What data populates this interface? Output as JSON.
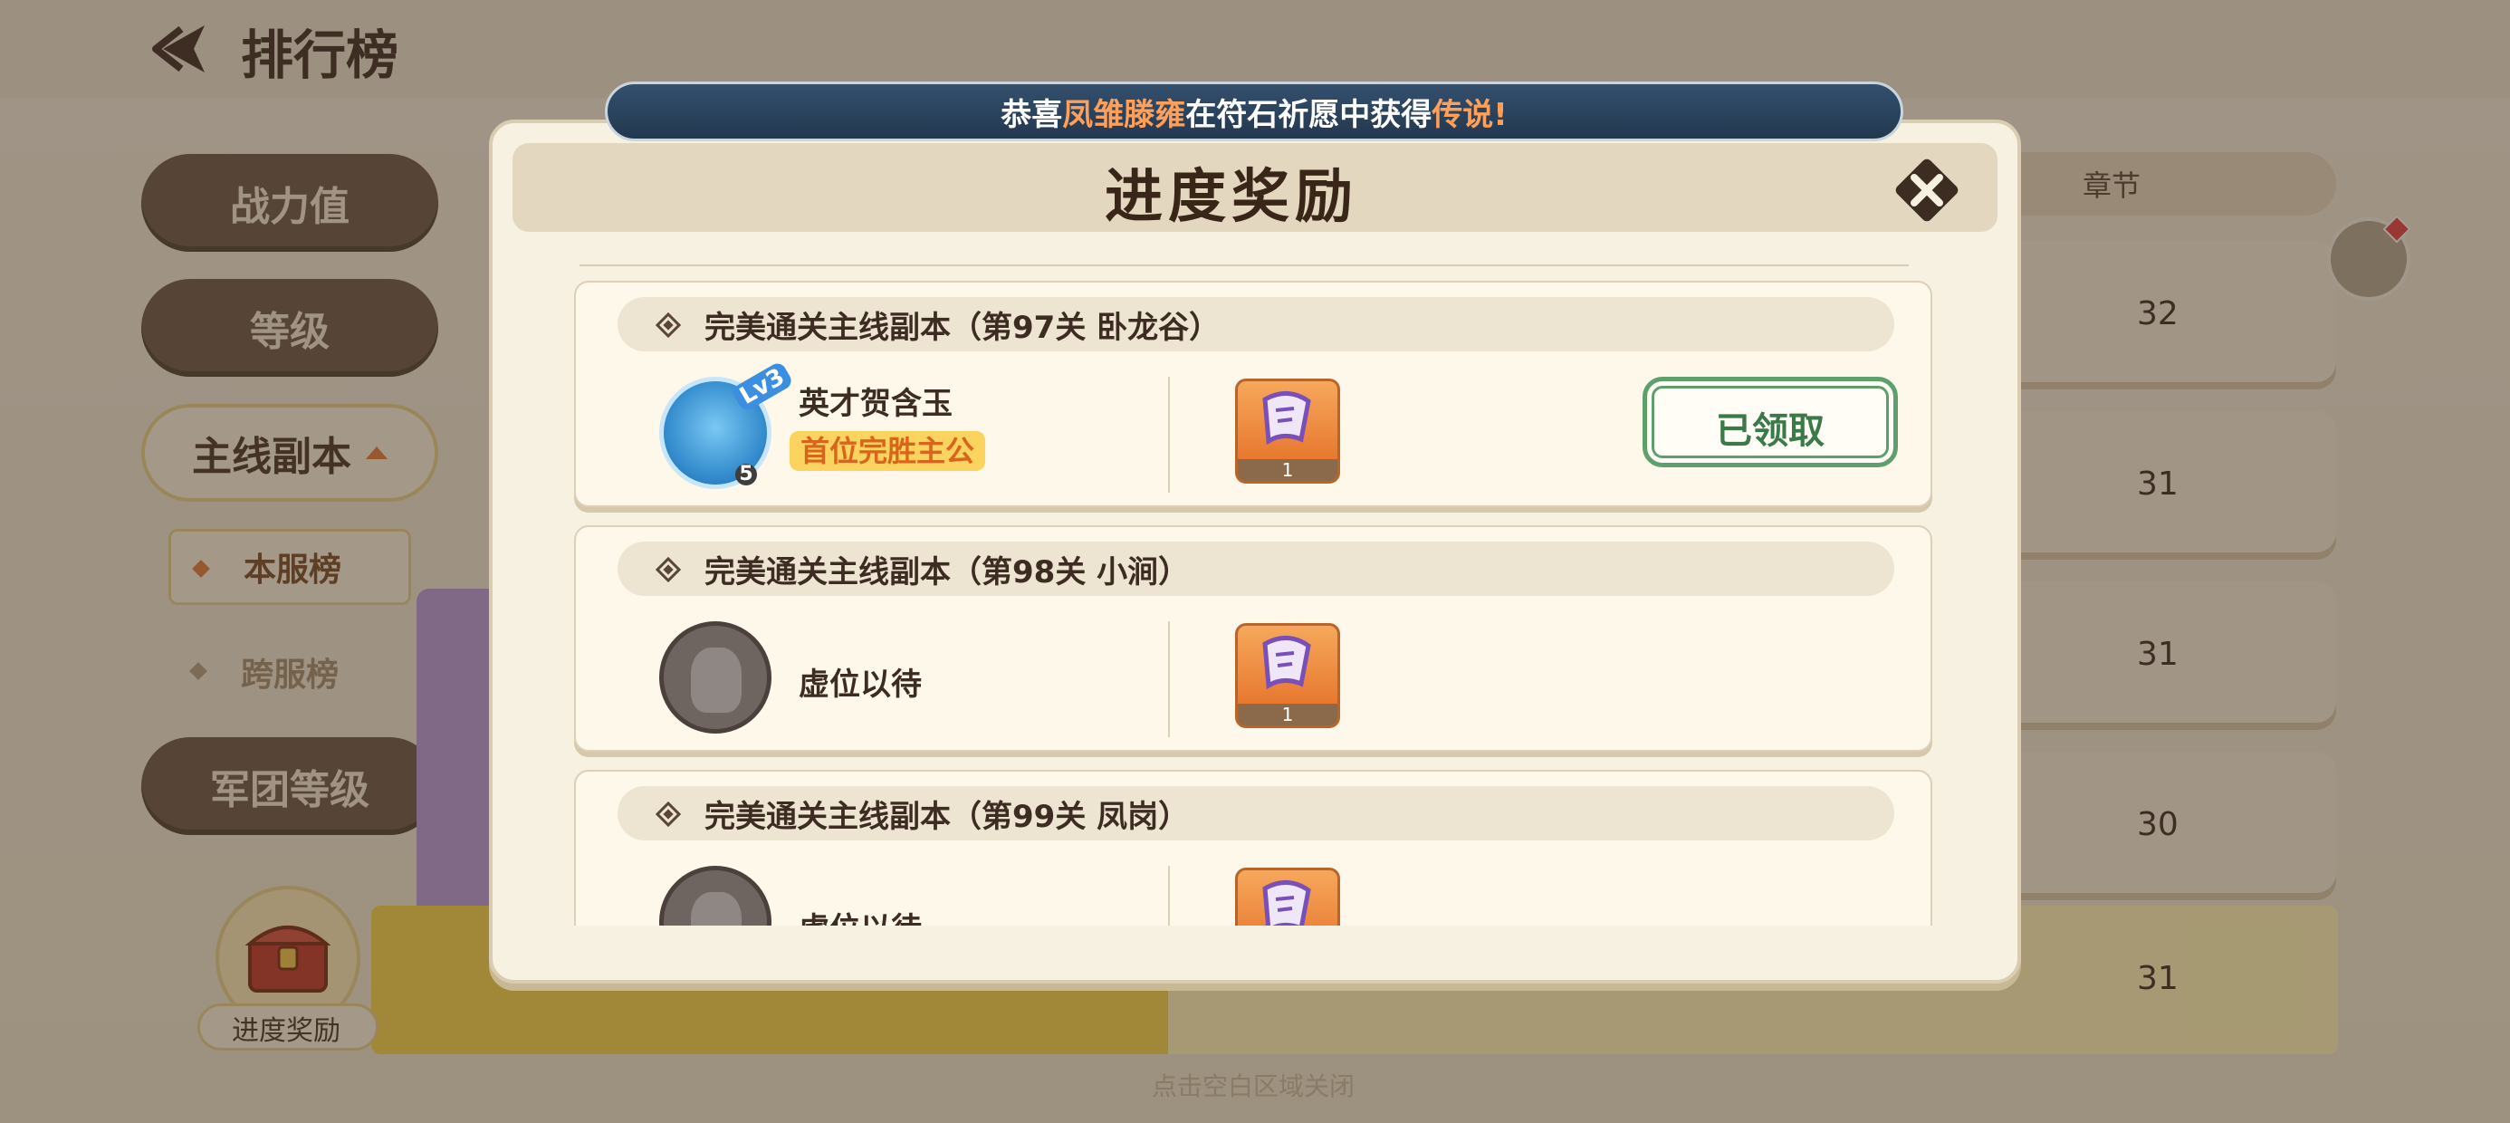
{
  "page": {
    "title": "排行榜",
    "close_hint": "点击空白区域关闭"
  },
  "sidebar": {
    "tabs": [
      {
        "label": "战力值",
        "active": false
      },
      {
        "label": "等级",
        "active": false
      },
      {
        "label": "主线副本",
        "active": true
      },
      {
        "label": "军团等级",
        "active": false
      }
    ],
    "sub_tabs": [
      {
        "label": "本服榜",
        "active": true
      },
      {
        "label": "跨服榜",
        "active": false
      }
    ]
  },
  "leaderboard": {
    "column_header": "章节",
    "chapter_values": [
      "32",
      "31",
      "31",
      "30",
      "31"
    ]
  },
  "chest_button": {
    "label": "进度奖励"
  },
  "banner": {
    "prefix": "恭喜",
    "player": "凤雏滕雍",
    "middle": "在符石祈愿中获得",
    "item": "传说!"
  },
  "modal": {
    "title": "进度奖励",
    "cards": [
      {
        "title": "完美通关主线副本（第97关 卧龙谷）",
        "player_name": "英才贺含玉",
        "player_tag": "首位完胜主公",
        "avatar_level_badge": "Lv3",
        "avatar_level_num": "5",
        "reward_qty": "1",
        "claimed": true,
        "claimed_label": "已领取"
      },
      {
        "title": "完美通关主线副本（第98关 小涧）",
        "player_name": "虚位以待",
        "reward_qty": "1",
        "claimed": false
      },
      {
        "title": "完美通关主线副本（第99关 凤岗）",
        "player_name": "虚位以待",
        "reward_qty": "",
        "claimed": false
      }
    ]
  },
  "colors": {
    "banner_highlight": "#ff9f5a",
    "tag_text": "#d9651c",
    "claimed_green": "#3a7a48"
  }
}
